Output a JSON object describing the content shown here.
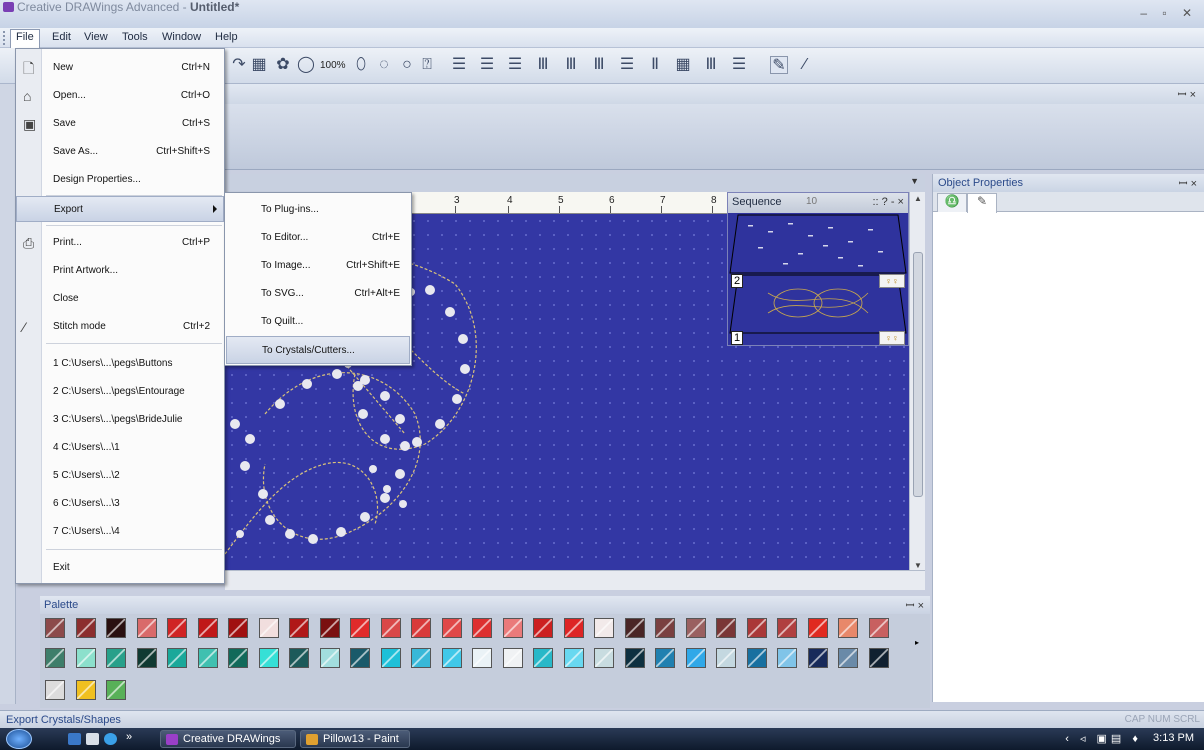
{
  "window": {
    "title_prefix": "Creative DRAWings Advanced - ",
    "title_doc": "Untitled*",
    "controls": "– ▫ ✕"
  },
  "menubar": [
    "File",
    "Edit",
    "View",
    "Tools",
    "Window",
    "Help"
  ],
  "toolbar": {
    "zoom": "100%"
  },
  "file_menu": [
    {
      "label": "New",
      "shortcut": "Ctrl+N",
      "icon": "new-document-icon"
    },
    {
      "label": "Open...",
      "shortcut": "Ctrl+O",
      "icon": "open-folder-icon"
    },
    {
      "label": "Save",
      "shortcut": "Ctrl+S",
      "icon": "save-disk-icon"
    },
    {
      "label": "Save As...",
      "shortcut": "Ctrl+Shift+S"
    },
    {
      "label": "Design Properties...",
      "shortcut": ""
    },
    {
      "label": "Export",
      "shortcut": "",
      "submenu": true
    },
    {
      "label": "Print...",
      "shortcut": "Ctrl+P",
      "icon": "printer-icon"
    },
    {
      "label": "Print Artwork...",
      "shortcut": ""
    },
    {
      "label": "Close",
      "shortcut": ""
    },
    {
      "label": "Stitch mode",
      "shortcut": "Ctrl+2",
      "icon": "stitch-mode-icon"
    },
    {
      "label": "1 C:\\Users\\...\\pegs\\Buttons",
      "shortcut": ""
    },
    {
      "label": "2 C:\\Users\\...\\pegs\\Entourage",
      "shortcut": ""
    },
    {
      "label": "3 C:\\Users\\...\\pegs\\BrideJulie",
      "shortcut": ""
    },
    {
      "label": "4 C:\\Users\\...\\1",
      "shortcut": ""
    },
    {
      "label": "5 C:\\Users\\...\\2",
      "shortcut": ""
    },
    {
      "label": "6 C:\\Users\\...\\3",
      "shortcut": ""
    },
    {
      "label": "7 C:\\Users\\...\\4",
      "shortcut": ""
    },
    {
      "label": "Exit",
      "shortcut": ""
    }
  ],
  "export_menu": [
    {
      "label": "To Plug-ins...",
      "shortcut": ""
    },
    {
      "label": "To Editor...",
      "shortcut": "Ctrl+E"
    },
    {
      "label": "To Image...",
      "shortcut": "Ctrl+Shift+E"
    },
    {
      "label": "To SVG...",
      "shortcut": "Ctrl+Alt+E"
    },
    {
      "label": "To Quilt...",
      "shortcut": ""
    },
    {
      "label": "To Crystals/Cutters...",
      "shortcut": ""
    }
  ],
  "ruler": [
    "3",
    "4",
    "5",
    "6",
    "7",
    "8"
  ],
  "sequence": {
    "title": "Sequence",
    "controls": ":: ? - ×",
    "ruler_label": "10",
    "layers": [
      "2",
      "1"
    ]
  },
  "object_properties": {
    "title": "Object Properties",
    "pin": "ꟷ ×"
  },
  "palette": {
    "title": "Palette",
    "pin": "ꟷ ×",
    "row1": [
      "#8c4a4a",
      "#8c2e2e",
      "#2a1010",
      "#d96a6a",
      "#d02424",
      "#c01818",
      "#a01010",
      "#f1dede",
      "#b01818",
      "#7a1010",
      "#e02a2a",
      "#d94848",
      "#d83a3a",
      "#e04848",
      "#dd3030",
      "#ea7a7a",
      "#cc2020",
      "#dd2424",
      "#f2eaea",
      "#4a2626",
      "#7a4040",
      "#9a6060",
      "#7a3636",
      "#aa3838",
      "#b04040",
      "#e02a20",
      "#e8886a",
      "#c86060"
    ],
    "row2": [
      "#3e7e6a",
      "#8ce0cc",
      "#28a08a",
      "#103a32",
      "#1aa89a",
      "#40c0b0",
      "#126a5a",
      "#36e0d6",
      "#1c5a5a",
      "#a2dede",
      "#1a5a6a",
      "#1ec0d8",
      "#38b8d8",
      "#40c8e8",
      "#eaf2f6",
      "#f0f2f4",
      "#28b8c8",
      "#68d8f0",
      "#c8dce0",
      "#0e3040",
      "#2080b0",
      "#30a8e8",
      "#c4d8e0",
      "#1870a0",
      "#80c4e8",
      "#182a5a",
      "#6a8aa8",
      "#102030"
    ],
    "row3": [
      "#dcdcdc",
      "#f0c020",
      "#58b058"
    ]
  },
  "status": {
    "text": "Export Crystals/Shapes",
    "indicators": "CAP NUM SCRL"
  },
  "taskbar": {
    "apps": [
      "Creative DRAWings ...",
      "Pillow13 - Paint"
    ],
    "time": "3:13 PM",
    "chevron": "»"
  }
}
